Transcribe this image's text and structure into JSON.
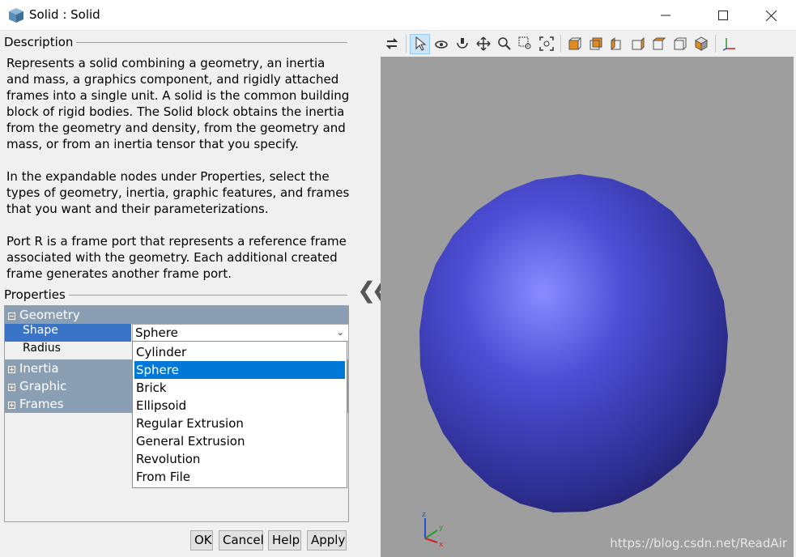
{
  "window": {
    "title": "Solid : Solid",
    "app_icon": "cube-icon",
    "controls": [
      "minimize-icon",
      "maximize-icon",
      "close-icon"
    ]
  },
  "description": {
    "heading": "Description",
    "paragraphs": [
      "Represents a solid combining a geometry, an inertia and mass, a graphics component, and rigidly attached frames into a single unit. A solid is the common building block of rigid bodies. The Solid block obtains the inertia from the geometry and density, from the geometry and mass, or from an inertia tensor that you specify.",
      "In the expandable nodes under Properties, select the types of geometry, inertia, graphic features, and frames that you want and their parameterizations.",
      "Port R is a frame port that represents a reference frame associated with the geometry. Each additional created frame generates another frame port."
    ]
  },
  "properties": {
    "heading": "Properties",
    "groups": {
      "geometry": "Geometry",
      "inertia": "Inertia",
      "graphic": "Graphic",
      "frames": "Frames"
    },
    "shape_label": "Shape",
    "shape_value": "Sphere",
    "radius_label": "Radius",
    "shape_options": [
      "Cylinder",
      "Sphere",
      "Brick",
      "Ellipsoid",
      "Regular Extrusion",
      "General Extrusion",
      "Revolution",
      "From File"
    ],
    "selected_option": "Sphere"
  },
  "buttons": {
    "ok": "OK",
    "cancel": "Cancel",
    "help": "Help",
    "apply": "Apply"
  },
  "viewer": {
    "toolbar_icons": [
      "swap-arrows-icon",
      "select-arrow-icon",
      "rotate-icon",
      "roll-icon",
      "pan-icon",
      "zoom-icon",
      "zoom-box-icon",
      "fit-view-icon",
      "front-view-icon",
      "back-view-icon",
      "left-view-icon",
      "right-view-icon",
      "top-view-icon",
      "bottom-view-icon",
      "isometric-view-icon",
      "axes-icon"
    ],
    "collapse_icon": "double-chevron-left-icon",
    "background_color": "#9e9e9e",
    "sphere_color": "#4a4ad0",
    "triad_labels": {
      "x": "x",
      "y": "y",
      "z": "z"
    },
    "watermark": "https://blog.csdn.net/ReadAir"
  }
}
